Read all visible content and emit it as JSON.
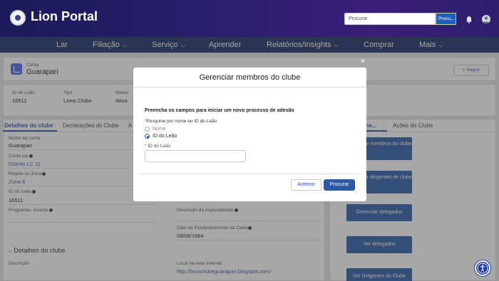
{
  "header": {
    "brand": "Lion Portal",
    "search_placeholder": "Procurar",
    "search_button": "Procu..."
  },
  "nav": {
    "items": [
      {
        "label": "Lar"
      },
      {
        "label": "Filiação"
      },
      {
        "label": "Serviço"
      },
      {
        "label": "Aprender"
      },
      {
        "label": "Relatórios/Insights"
      },
      {
        "label": "Comprar"
      },
      {
        "label": "Mais"
      }
    ]
  },
  "account": {
    "type_label": "Conta",
    "name": "Guarapari",
    "follow_label": "Seguir",
    "highlights": {
      "id_label": "ID do Leão",
      "id_value": "16511",
      "type_label": "Tipo",
      "type_value": "Lions Clube",
      "status_label": "Status",
      "status_value": "Ativo"
    }
  },
  "left_tabs": {
    "tab1": "Detalhes do clube",
    "tab2": "Declarações do Clube",
    "tab3": "A"
  },
  "details": {
    "account_name_label": "Nome da conta",
    "account_name_value": "Guarapari",
    "parent_label": "Conta pai",
    "parent_value": "Distrito LC 11",
    "region_label": "Região ou Zona",
    "region_value": "Zona 8",
    "lion_id_label": "ID do Leão",
    "lion_id_value": "16511",
    "youth_label": "Programas Juvenis",
    "specialty_label": "Descrição da especialidade",
    "charter_label": "Data de Estabelecimento da Carta",
    "charter_value": "08/08/1964",
    "section_title": "Detalhes do clube",
    "description_label": "Descrição",
    "website_label": "Local na rede Internet",
    "website_value": "http://lionsclubeguarapari.blogspot.com/"
  },
  "right_panel": {
    "tab1": "me...",
    "tab2": "Ações do Clube",
    "buttons": {
      "manage_members": "Gerenciar membros do clube",
      "manage_leaders": "Gerenciar dirigentes de clube",
      "manage_delegates": "Gerenciar delegados",
      "view_delegates": "Ver delegados",
      "view_leaders": "Ver Dirigentes do Clube"
    }
  },
  "modal": {
    "title": "Gerenciar membros do clube",
    "instruction": "Preencha os campos para iniciar um novo processo de adesão",
    "search_by_label": "Pesquise por nome ou ID do Leão",
    "required_mark": "*",
    "option_name": "Nome",
    "option_id": "ID do Leão",
    "id_field_label": "ID do Leão",
    "id_field_value": "",
    "prev_button": "Anterior",
    "next_button": "Procurar",
    "close_symbol": "×"
  },
  "colors": {
    "primary": "#2c5aa8",
    "header_bg": "#1b1a5a",
    "nav_bg": "#1c2f66"
  }
}
